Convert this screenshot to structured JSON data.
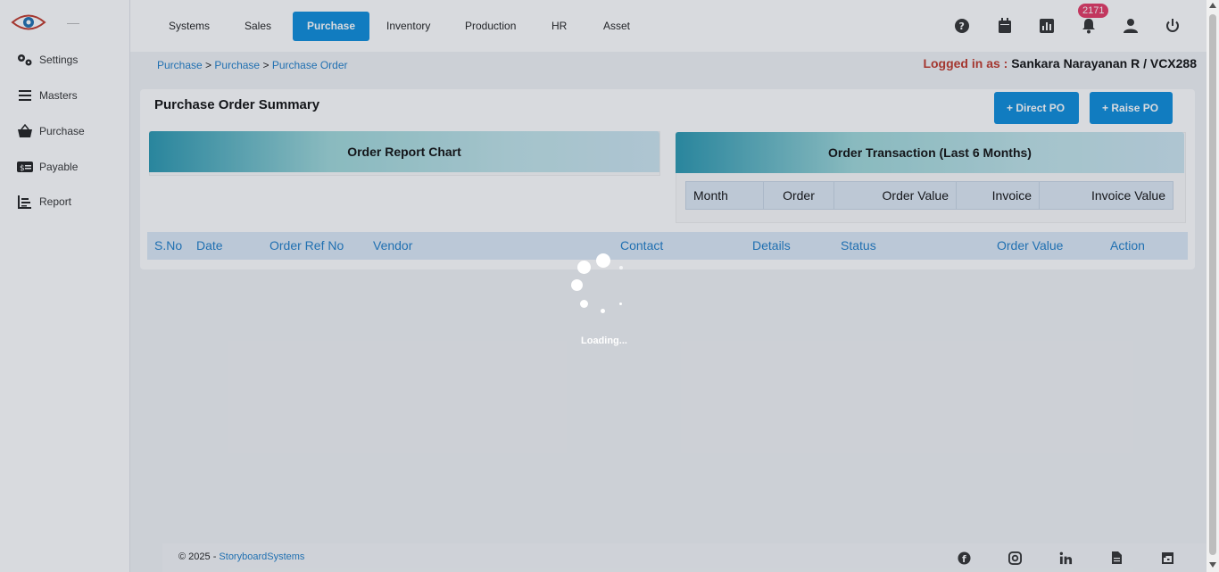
{
  "sidebar": {
    "items": [
      {
        "label": "Settings",
        "icon": "gears-icon"
      },
      {
        "label": "Masters",
        "icon": "menu-icon"
      },
      {
        "label": "Purchase",
        "icon": "basket-icon"
      },
      {
        "label": "Payable",
        "icon": "money-icon"
      },
      {
        "label": "Report",
        "icon": "chart-icon"
      }
    ]
  },
  "topnav": {
    "items": [
      "Systems",
      "Sales",
      "Purchase",
      "Inventory",
      "Production",
      "HR",
      "Asset"
    ],
    "active": "Purchase",
    "notification_count": "2171"
  },
  "breadcrumb": {
    "items": [
      "Purchase",
      "Purchase",
      "Purchase Order"
    ],
    "sep": ">"
  },
  "logged_in": {
    "label": "Logged in as :",
    "user": "Sankara Narayanan R / VCX288"
  },
  "summary": {
    "title": "Purchase Order Summary",
    "direct_po": "Direct PO",
    "raise_po": "Raise PO",
    "order_report_chart": "Order Report Chart",
    "order_transaction_title": "Order Transaction (Last 6 Months)",
    "transaction_columns": [
      "Month",
      "Order",
      "Order Value",
      "Invoice",
      "Invoice Value"
    ]
  },
  "po_table": {
    "columns": [
      "S.No",
      "Date",
      "Order Ref No",
      "Vendor",
      "Contact",
      "Details",
      "Status",
      "Order Value",
      "Action"
    ]
  },
  "loading_text": "Loading...",
  "footer": {
    "copyright": "© 2025 - ",
    "company": "StoryboardSystems"
  },
  "colors": {
    "accent": "#0d8ddb",
    "badge": "#e53965",
    "logged_label": "#c0392b",
    "header_link": "#1f7ec9"
  }
}
